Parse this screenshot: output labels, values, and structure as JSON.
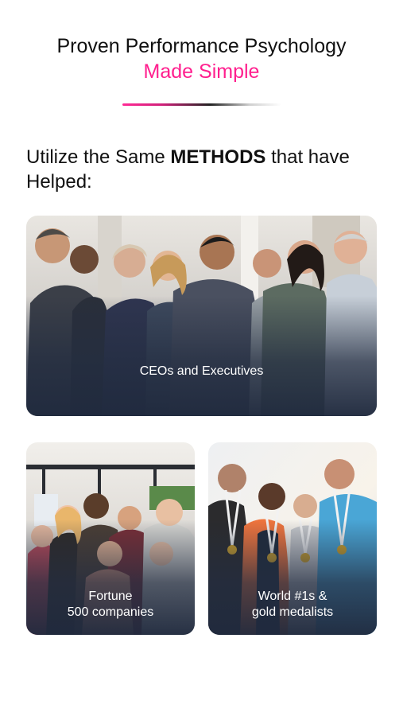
{
  "header": {
    "title_line1": "Proven Performance Psychology",
    "title_line2": "Made Simple",
    "accent_color": "#ff1f8e"
  },
  "intro": {
    "prefix": "Utilize the Same ",
    "emphasis": "METHODS",
    "suffix": " that have Helped:"
  },
  "cards": [
    {
      "label": "CEOs and Executives",
      "image": "business-team-photo"
    },
    {
      "label_line1": "Fortune",
      "label_line2": "500 companies",
      "image": "office-team-photo"
    },
    {
      "label_line1": "World #1s &",
      "label_line2": "gold medalists",
      "image": "athletes-medals-photo"
    }
  ]
}
